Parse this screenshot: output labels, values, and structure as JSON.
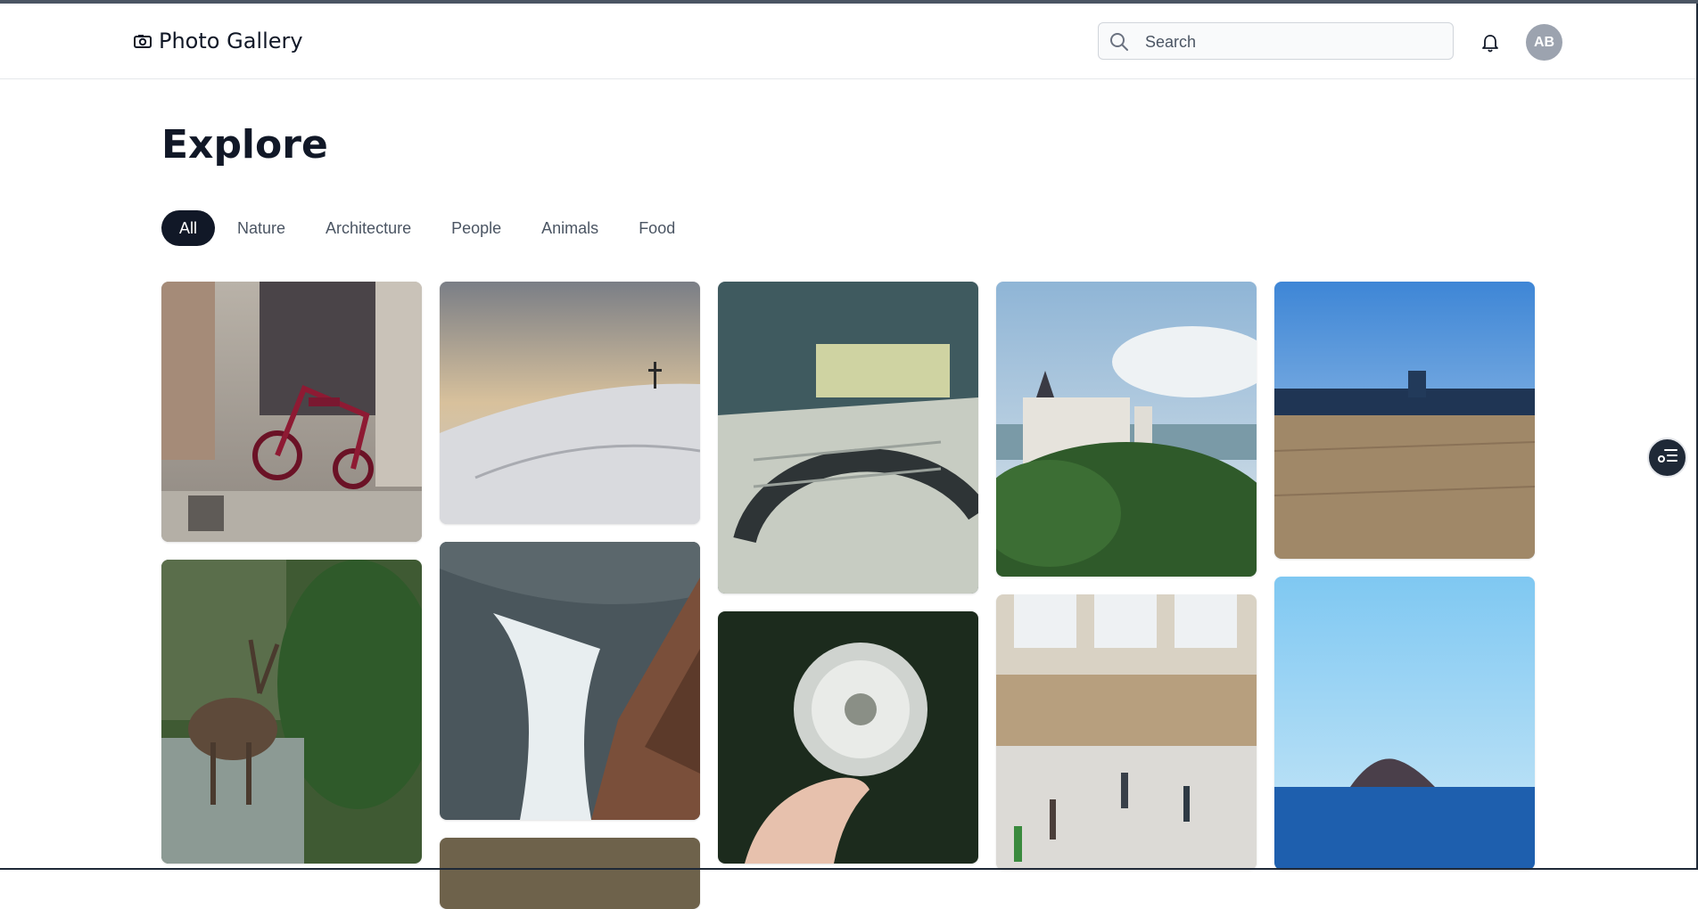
{
  "header": {
    "brand_icon": "camera-icon",
    "title": "Photo Gallery",
    "search_placeholder": "Search",
    "search_value": "",
    "notification_icon": "bell-icon",
    "avatar_initials": "AB"
  },
  "main": {
    "title": "Explore",
    "filters": [
      {
        "label": "All",
        "active": true
      },
      {
        "label": "Nature",
        "active": false
      },
      {
        "label": "Architecture",
        "active": false
      },
      {
        "label": "People",
        "active": false
      },
      {
        "label": "Animals",
        "active": false
      },
      {
        "label": "Food",
        "active": false
      }
    ],
    "photos": [
      {
        "subject": "red tricycle chained by a door"
      },
      {
        "subject": "snowy hill with a cross at sunset"
      },
      {
        "subject": "blurred desk with papers and a protractor"
      },
      {
        "subject": "castle on a forested hill"
      },
      {
        "subject": "wooden deck under blue sky"
      },
      {
        "subject": "deer in a stream by trees"
      },
      {
        "subject": "waves crashing on rocks"
      },
      {
        "subject": "hand holding a dandelion"
      },
      {
        "subject": "busy train station hall"
      },
      {
        "subject": "small island on a blue sea"
      },
      {
        "subject": "partially visible photo"
      }
    ]
  },
  "floating_button_icon": "list-settings-icon",
  "colors": {
    "accent": "#111827",
    "muted_text": "#4b5563",
    "border": "#e5e7eb",
    "avatar_bg": "#9ca3af"
  }
}
